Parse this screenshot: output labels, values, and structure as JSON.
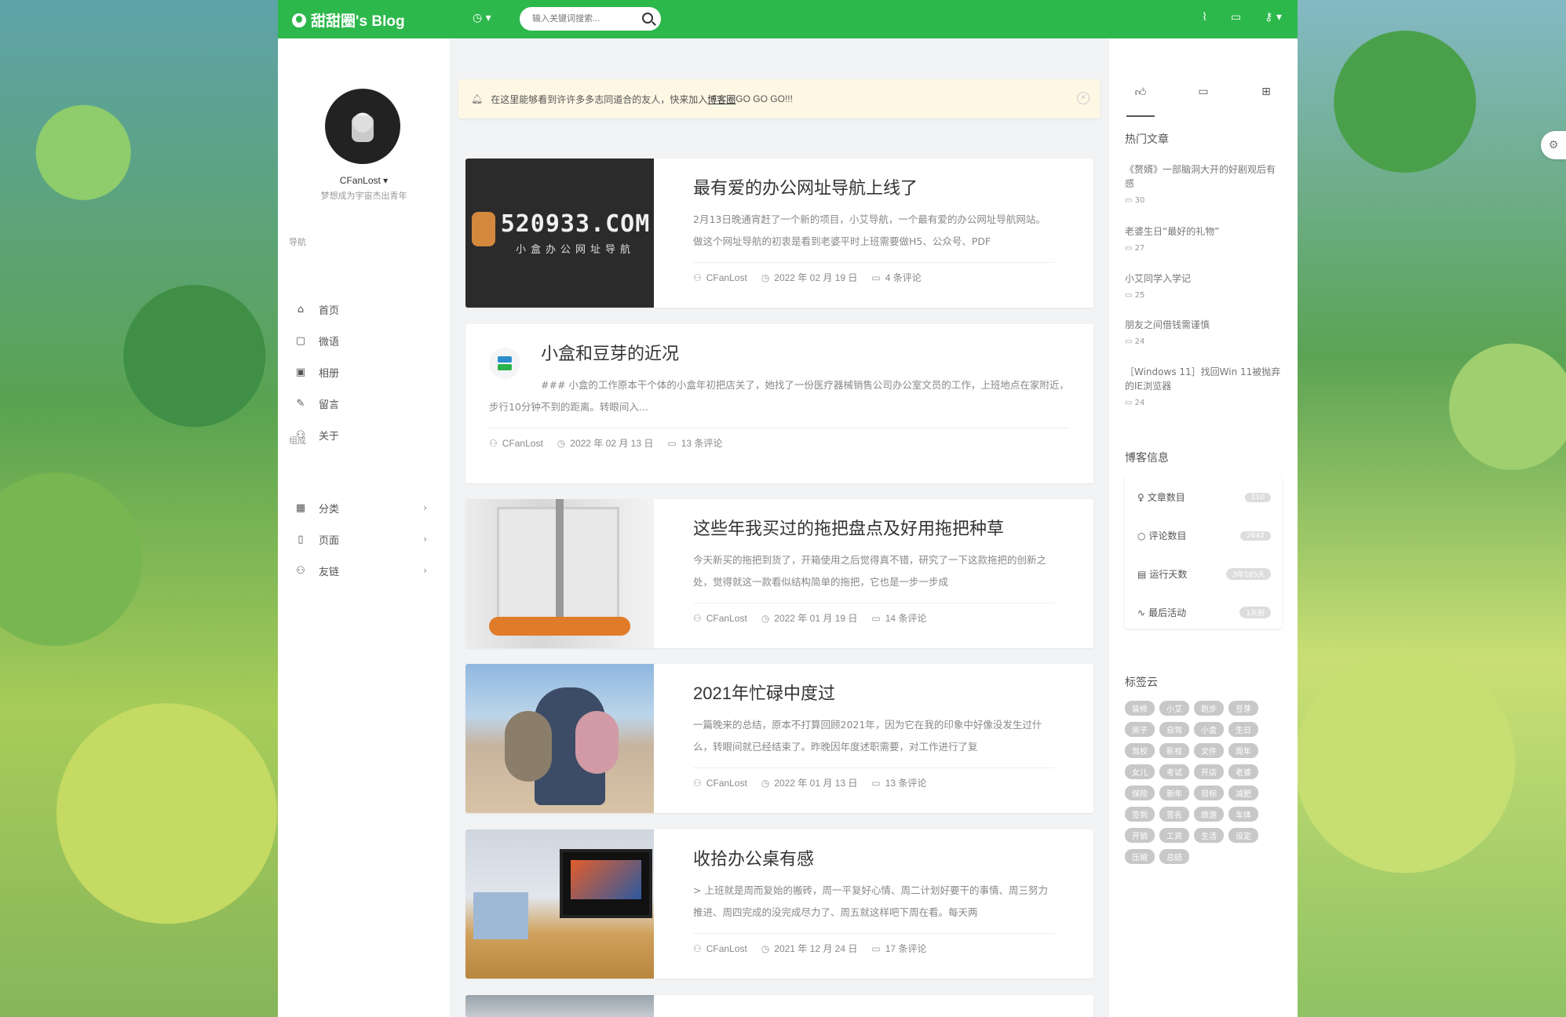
{
  "topbar": {
    "logo_text": "甜甜圈's Blog",
    "clock_icon": "clock-icon",
    "search_placeholder": "输入关键词搜索...",
    "icons": [
      "rss-icon",
      "chat-icon",
      "key-icon"
    ],
    "accent": "#2db84c"
  },
  "sidebar": {
    "user_name": "CFanLost ▾",
    "user_subtitle": "梦想成为宇宙杰出青年",
    "nav_title": "导航",
    "nav_items": [
      {
        "label": "首页",
        "icon": "home-icon"
      },
      {
        "label": "微语",
        "icon": "message-icon"
      },
      {
        "label": "相册",
        "icon": "image-icon"
      },
      {
        "label": "留言",
        "icon": "edit-icon"
      },
      {
        "label": "关于",
        "icon": "user-icon"
      }
    ],
    "group_title": "组成",
    "group_items": [
      {
        "label": "分类",
        "icon": "grid-icon"
      },
      {
        "label": "页面",
        "icon": "file-icon"
      },
      {
        "label": "友链",
        "icon": "user-icon"
      }
    ]
  },
  "notice": {
    "text_before": "在这里能够看到许许多多志同道合的友人，快来加入",
    "link_text": "博客圈",
    "text_after": "GO GO GO!!!"
  },
  "posts": [
    {
      "title": "最有爱的办公网址导航上线了",
      "excerpt": "2月13日晚通宵赶了一个新的项目，小艾导航，一个最有爱的办公网址导航网站。做这个网址导航的初衷是看到老婆平时上班需要做H5、公众号、PDF",
      "author": "CFanLost",
      "date": "2022 年 02 月 19 日",
      "comments": "4 条评论",
      "thumb_big": "520933.COM",
      "thumb_small": "小盒办公网址导航"
    },
    {
      "title": "小盒和豆芽的近况",
      "excerpt": "### 小盒的工作原本干个体的小盒年初把店关了，她找了一份医疗器械销售公司办公室文员的工作，上班地点在家附近，步行10分钟不到的距离。转眼间入...",
      "author": "CFanLost",
      "date": "2022 年 02 月 13 日",
      "comments": "13 条评论"
    },
    {
      "title": "这些年我买过的拖把盘点及好用拖把种草",
      "excerpt": "今天新买的拖把到货了，开箱使用之后觉得真不错，研究了一下这款拖把的创新之处，觉得就这一款看似结构简单的拖把，它也是一步一步成",
      "author": "CFanLost",
      "date": "2022 年 01 月 19 日",
      "comments": "14 条评论"
    },
    {
      "title": "2021年忙碌中度过",
      "excerpt": "一篇晚来的总结，原本不打算回顾2021年，因为它在我的印象中好像没发生过什么，转眼间就已经结束了。昨晚因年度述职需要，对工作进行了复",
      "author": "CFanLost",
      "date": "2022 年 01 月 13 日",
      "comments": "13 条评论"
    },
    {
      "title": "收拾办公桌有感",
      "excerpt": "> 上班就是周而复始的搬砖，周一平复好心情、周二计划好要干的事情、周三努力推进、周四完成的没完成尽力了、周五就这样吧下周在看。每天两",
      "author": "CFanLost",
      "date": "2021 年 12 月 24 日",
      "comments": "17 条评论"
    }
  ],
  "right": {
    "tabs": [
      "thumbs-up-icon",
      "comment-icon",
      "gift-icon"
    ],
    "hot_title": "热门文章",
    "hot": [
      {
        "title": "《赘婿》一部脑洞大开的好剧观后有感",
        "count": "30"
      },
      {
        "title": "老婆生日“最好的礼物”",
        "count": "27"
      },
      {
        "title": "小艾同学入学记",
        "count": "25"
      },
      {
        "title": "朋友之间借钱需谨慎",
        "count": "24"
      },
      {
        "title": "［Windows 11］找回Win 11被抛弃的IE浏览器",
        "count": "24"
      }
    ],
    "info_title": "博客信息",
    "info": [
      {
        "label": "文章数目",
        "value": "110",
        "icon": "bulb-icon"
      },
      {
        "label": "评论数目",
        "value": "2642",
        "icon": "comment-icon"
      },
      {
        "label": "运行天数",
        "value": "3年185天",
        "icon": "calendar-icon"
      },
      {
        "label": "最后活动",
        "value": "1天前",
        "icon": "activity-icon"
      }
    ],
    "tags_title": "标签云",
    "tags": [
      "装修",
      "小艾",
      "跑步",
      "豆芽",
      "房子",
      "自驾",
      "小盒",
      "生日",
      "驾校",
      "影视",
      "文件",
      "周年",
      "女儿",
      "考试",
      "开店",
      "老婆",
      "保险",
      "新年",
      "目标",
      "减肥",
      "签到",
      "签名",
      "旅游",
      "车体",
      "开销",
      "工资",
      "生活",
      "设定",
      "压缩",
      "总结"
    ]
  }
}
